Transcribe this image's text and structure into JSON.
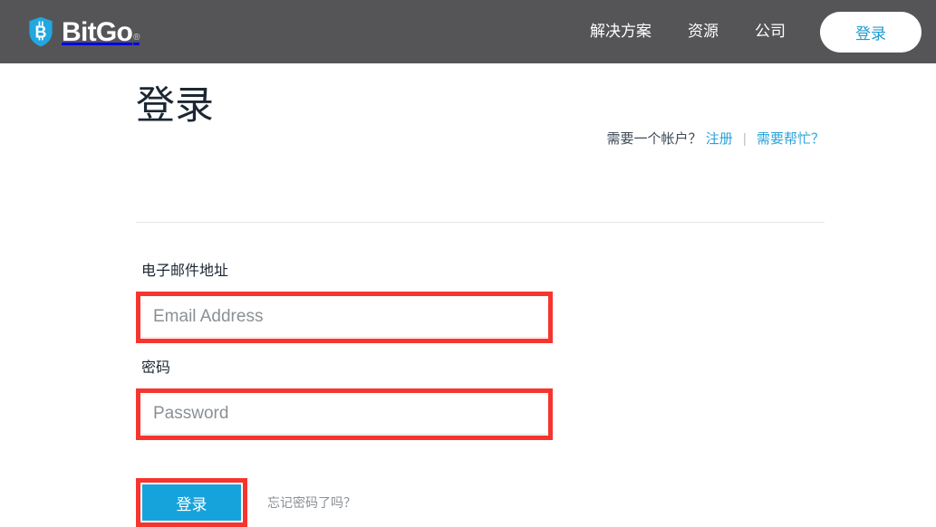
{
  "header": {
    "brand": {
      "icon": "bitcoin-shield-icon",
      "wordmark": "BitGo",
      "registered_mark": "®"
    },
    "nav_items": [
      {
        "label": "解决方案",
        "name": "nav-solutions"
      },
      {
        "label": "资源",
        "name": "nav-resources"
      },
      {
        "label": "公司",
        "name": "nav-company"
      }
    ],
    "login_button": "登录",
    "background_color": "#555557",
    "login_text_color": "#1d9bd1"
  },
  "page": {
    "title": "登录",
    "helper": {
      "question": "需要一个帐户？",
      "signup_link": "注册",
      "separator": "|",
      "help_link": "需要帮忙？"
    }
  },
  "form": {
    "email": {
      "label": "电子邮件地址",
      "placeholder": "Email Address",
      "value": ""
    },
    "password": {
      "label": "密码",
      "placeholder": "Password",
      "value": ""
    },
    "submit_label": "登录",
    "forgot_password": "忘记密码了吗？",
    "submit_color": "#16a3dc",
    "annotation_color": "#f7352e"
  }
}
